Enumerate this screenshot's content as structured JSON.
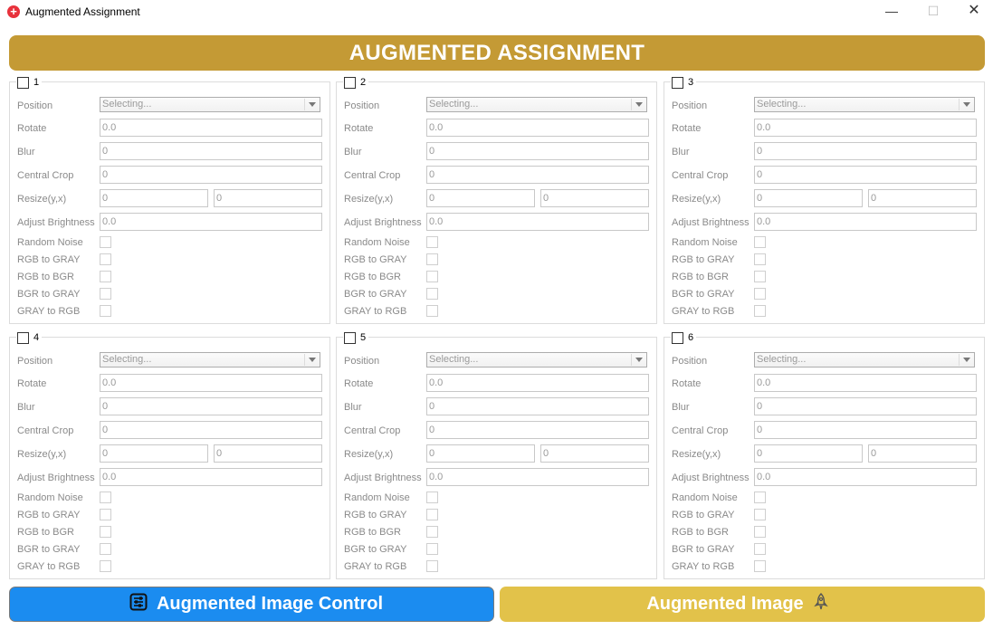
{
  "window": {
    "title": "Augmented Assignment",
    "app_icon": "plus-circle-icon",
    "minimize_glyph": "—",
    "maximize_glyph": "☐",
    "close_glyph": "✕"
  },
  "header": {
    "title": "AUGMENTED ASSIGNMENT",
    "color": "#c49a35"
  },
  "labels": {
    "position": "Position",
    "rotate": "Rotate",
    "blur": "Blur",
    "central_crop": "Central Crop",
    "resize": "Resize(y,x)",
    "adjust_brightness": "Adjust Brightness",
    "random_noise": "Random Noise",
    "rgb_to_gray": "RGB to GRAY",
    "rgb_to_bgr": "RGB to BGR",
    "bgr_to_gray": "BGR to GRAY",
    "gray_to_rgb": "GRAY to RGB"
  },
  "groups": [
    {
      "number": "1",
      "position": "Selecting...",
      "rotate": "0.0",
      "blur": "0",
      "central_crop": "0",
      "resize_y": "0",
      "resize_x": "0",
      "brightness": "0.0"
    },
    {
      "number": "2",
      "position": "Selecting...",
      "rotate": "0.0",
      "blur": "0",
      "central_crop": "0",
      "resize_y": "0",
      "resize_x": "0",
      "brightness": "0.0"
    },
    {
      "number": "3",
      "position": "Selecting...",
      "rotate": "0.0",
      "blur": "0",
      "central_crop": "0",
      "resize_y": "0",
      "resize_x": "0",
      "brightness": "0.0"
    },
    {
      "number": "4",
      "position": "Selecting...",
      "rotate": "0.0",
      "blur": "0",
      "central_crop": "0",
      "resize_y": "0",
      "resize_x": "0",
      "brightness": "0.0"
    },
    {
      "number": "5",
      "position": "Selecting...",
      "rotate": "0.0",
      "blur": "0",
      "central_crop": "0",
      "resize_y": "0",
      "resize_x": "0",
      "brightness": "0.0"
    },
    {
      "number": "6",
      "position": "Selecting...",
      "rotate": "0.0",
      "blur": "0",
      "central_crop": "0",
      "resize_y": "0",
      "resize_x": "0",
      "brightness": "0.0"
    }
  ],
  "buttons": {
    "control": {
      "label": "Augmented Image Control",
      "icon": "sliders-icon",
      "color": "#1b8cf0"
    },
    "image": {
      "label": "Augmented Image",
      "icon": "rocket-icon",
      "color": "#e2c24a"
    }
  }
}
